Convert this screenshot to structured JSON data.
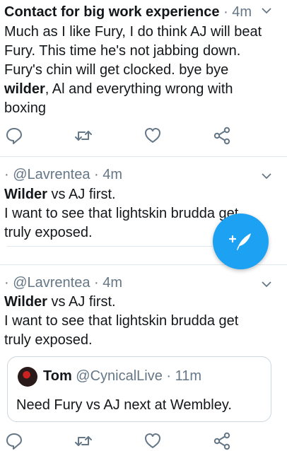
{
  "tweets": [
    {
      "name": "Contact for big work experience",
      "meta": " · 4m",
      "lines": [
        [
          {
            "t": "Much as I like Fury, I do think AJ will beat"
          }
        ],
        [
          {
            "t": "Fury. This time he's not jabbing down."
          }
        ],
        [
          {
            "t": "Fury's chin will get clocked. bye bye"
          }
        ],
        [
          {
            "t": "wilder",
            "b": true
          },
          {
            "t": ", Al and everything wrong with"
          }
        ],
        [
          {
            "t": "boxing"
          }
        ]
      ]
    },
    {
      "meta": "· @Lavrentea · 4m",
      "line1_bold": "Wilder",
      "line1_rest": " vs AJ first.",
      "line2": "I want to see that lightskin brudda get",
      "line3": "truly exposed."
    },
    {
      "meta": "· @Lavrentea · 4m",
      "line1_bold": "Wilder",
      "line1_rest": " vs AJ first.",
      "line2": "I want to see that lightskin brudda get",
      "line3": "truly exposed.",
      "quote": {
        "name": "Tom",
        "meta": " @CynicalLive · 11m",
        "text": "Need Fury vs AJ next at Wembley."
      }
    }
  ],
  "icons": {
    "reply": "reply-icon",
    "retweet": "retweet-icon",
    "like": "heart-icon",
    "share": "share-icon",
    "more": "chevron-down-icon",
    "compose": "compose-tweet-icon"
  },
  "colors": {
    "accent": "#1da1f2",
    "icon": "#657786",
    "text": "#14171a",
    "divider": "#e1e8ed"
  }
}
